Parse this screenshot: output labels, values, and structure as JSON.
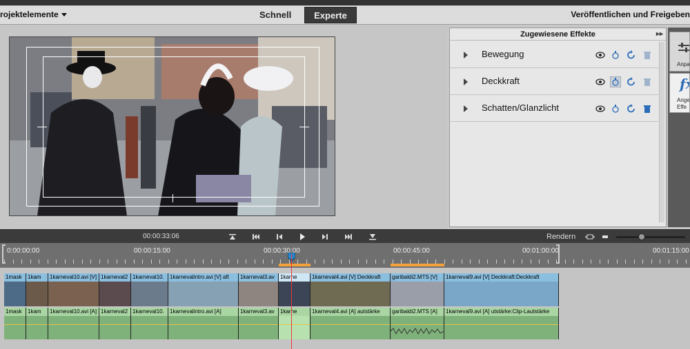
{
  "menubar": {
    "project_label": "rojektelemente",
    "mode_quick": "Schnell",
    "mode_expert": "Experte",
    "publish_label": "Veröffentlichen und Freigeben"
  },
  "effects_panel": {
    "title": "Zugewiesene Effekte",
    "items": [
      {
        "label": "Bewegung"
      },
      {
        "label": "Deckkraft"
      },
      {
        "label": "Schatten/Glanzlicht"
      }
    ]
  },
  "tools": {
    "adjust_label": "Anpas",
    "applied_effects_label_1": "Ange",
    "applied_effects_label_2": "Effe",
    "fx_glyph": "fx"
  },
  "transport": {
    "timecode": "00:00:33:06",
    "render_label": "Rendern"
  },
  "ruler": {
    "labels": [
      "0:00:00:00",
      "00:00:15:00",
      "00:00:30:00",
      "00:00:45:00",
      "00:01:00:00",
      "00:01:15:00"
    ]
  },
  "video_clips": [
    {
      "label": "1mask"
    },
    {
      "label": "1kam"
    },
    {
      "label": "1karneval10.avi [V]"
    },
    {
      "label": "1karneval2"
    },
    {
      "label": "1karneval10."
    },
    {
      "label": "1karnevalintro.avi [V]"
    },
    {
      "label": "aft"
    },
    {
      "label": "1karneval3.av"
    },
    {
      "label": "1karne"
    },
    {
      "label": "1karneval4.avi [V]"
    },
    {
      "label": "Deckkraft"
    },
    {
      "label": "garibaldi2.MTS [V]"
    },
    {
      "label": "1karneval9.avi [V]"
    },
    {
      "label": "Deckkraft:Deckkraft"
    }
  ],
  "audio_clips": [
    {
      "label": "1mask"
    },
    {
      "label": "1kam"
    },
    {
      "label": "1karneval10.avi [A]"
    },
    {
      "label": "1karneval2"
    },
    {
      "label": "1karneval10."
    },
    {
      "label": "1karnevalintro.avi [A]"
    },
    {
      "label": "1karneval3.av"
    },
    {
      "label": "1karne"
    },
    {
      "label": "1karneval4.avi [A]"
    },
    {
      "label": "autstärke"
    },
    {
      "label": "garibaldi2.MTS [A]"
    },
    {
      "label": "1karneval9.avi [A]"
    },
    {
      "label": "utstärke:Clip-Lautstärke"
    }
  ],
  "colors": {
    "video_cap": "#8bbfe0",
    "audio_clip": "#7fb27a",
    "playhead": "#ee3333",
    "workarea": "#f3a13b",
    "icon_blue": "#2b6cb8"
  }
}
